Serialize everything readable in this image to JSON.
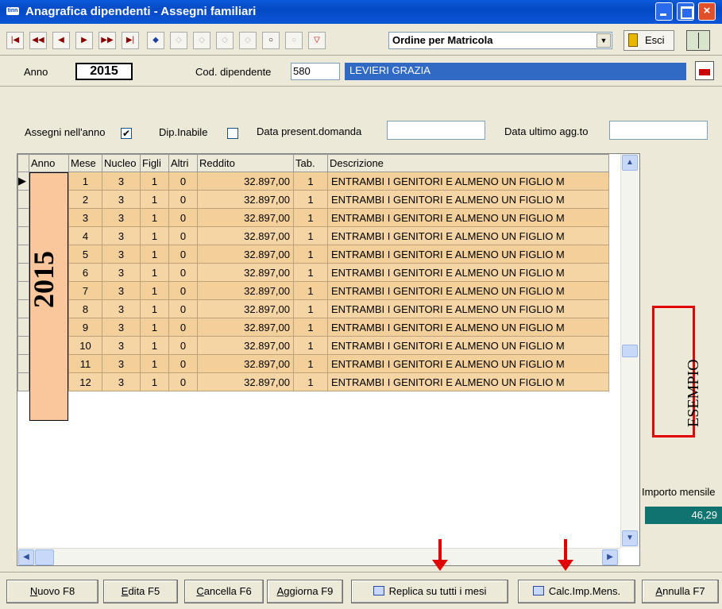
{
  "window": {
    "app_icon_text": "tinn",
    "title": "Anagrafica dipendenti - Assegni familiari",
    "close_glyph": "×"
  },
  "toolbar": {
    "nav_icons": [
      "|◀",
      "◀◀",
      "◀",
      "▶",
      "▶▶",
      "▶|"
    ],
    "sort_value": "Ordine per Matricola",
    "exit_label": "Esci"
  },
  "header": {
    "anno_label": "Anno",
    "anno_value": "2015",
    "cod_label": "Cod. dipendente",
    "cod_value": "580",
    "employee_name": "LEVIERI GRAZIA"
  },
  "filters": {
    "assegni_label": "Assegni nell'anno",
    "assegni_checked": "✔",
    "inabile_label": "Dip.Inabile",
    "data_present_label": "Data present.domanda",
    "data_agg_label": "Data ultimo agg.to"
  },
  "grid": {
    "columns": [
      "Anno",
      "Mese",
      "Nucleo",
      "Figli",
      "Altri",
      "Reddito",
      "Tab.",
      "Descrizione"
    ],
    "year_label": "2015",
    "rows": [
      {
        "mese": "1",
        "nucleo": "3",
        "figli": "1",
        "altri": "0",
        "reddito": "32.897,00",
        "tab": "1",
        "descr": "ENTRAMBI I GENITORI E ALMENO UN FIGLIO M"
      },
      {
        "mese": "2",
        "nucleo": "3",
        "figli": "1",
        "altri": "0",
        "reddito": "32.897,00",
        "tab": "1",
        "descr": "ENTRAMBI I GENITORI E ALMENO UN FIGLIO M"
      },
      {
        "mese": "3",
        "nucleo": "3",
        "figli": "1",
        "altri": "0",
        "reddito": "32.897,00",
        "tab": "1",
        "descr": "ENTRAMBI I GENITORI E ALMENO UN FIGLIO M"
      },
      {
        "mese": "4",
        "nucleo": "3",
        "figli": "1",
        "altri": "0",
        "reddito": "32.897,00",
        "tab": "1",
        "descr": "ENTRAMBI I GENITORI E ALMENO UN FIGLIO M"
      },
      {
        "mese": "5",
        "nucleo": "3",
        "figli": "1",
        "altri": "0",
        "reddito": "32.897,00",
        "tab": "1",
        "descr": "ENTRAMBI I GENITORI E ALMENO UN FIGLIO M"
      },
      {
        "mese": "6",
        "nucleo": "3",
        "figli": "1",
        "altri": "0",
        "reddito": "32.897,00",
        "tab": "1",
        "descr": "ENTRAMBI I GENITORI E ALMENO UN FIGLIO M"
      },
      {
        "mese": "7",
        "nucleo": "3",
        "figli": "1",
        "altri": "0",
        "reddito": "32.897,00",
        "tab": "1",
        "descr": "ENTRAMBI I GENITORI E ALMENO UN FIGLIO M"
      },
      {
        "mese": "8",
        "nucleo": "3",
        "figli": "1",
        "altri": "0",
        "reddito": "32.897,00",
        "tab": "1",
        "descr": "ENTRAMBI I GENITORI E ALMENO UN FIGLIO M"
      },
      {
        "mese": "9",
        "nucleo": "3",
        "figli": "1",
        "altri": "0",
        "reddito": "32.897,00",
        "tab": "1",
        "descr": "ENTRAMBI I GENITORI E ALMENO UN FIGLIO M"
      },
      {
        "mese": "10",
        "nucleo": "3",
        "figli": "1",
        "altri": "0",
        "reddito": "32.897,00",
        "tab": "1",
        "descr": "ENTRAMBI I GENITORI E ALMENO UN FIGLIO M"
      },
      {
        "mese": "11",
        "nucleo": "3",
        "figli": "1",
        "altri": "0",
        "reddito": "32.897,00",
        "tab": "1",
        "descr": "ENTRAMBI I GENITORI E ALMENO UN FIGLIO M"
      },
      {
        "mese": "12",
        "nucleo": "3",
        "figli": "1",
        "altri": "0",
        "reddito": "32.897,00",
        "tab": "1",
        "descr": "ENTRAMBI I GENITORI E ALMENO UN FIGLIO M"
      }
    ],
    "row_indicator": "▶"
  },
  "side": {
    "esempio": "ESEMPIO",
    "importo_label": "Importo mensile",
    "importo_value": "46,29"
  },
  "buttons": {
    "nuovo_u": "N",
    "nuovo_rest": "uovo F8",
    "edita_u": "E",
    "edita_rest": "dita F5",
    "cancella_u": "C",
    "cancella_rest": "ancella F6",
    "aggiorna_u": "A",
    "aggiorna_rest": "ggiorna F9",
    "replica": "Replica su tutti i mesi",
    "calc": "Calc.Imp.Mens.",
    "annulla_u": "A",
    "annulla_rest": "nnulla F7"
  },
  "colors": {
    "accent": "#316AC5",
    "row": "#F3CF99",
    "year_col": "#F9C79B",
    "annotation": "#E00000"
  }
}
